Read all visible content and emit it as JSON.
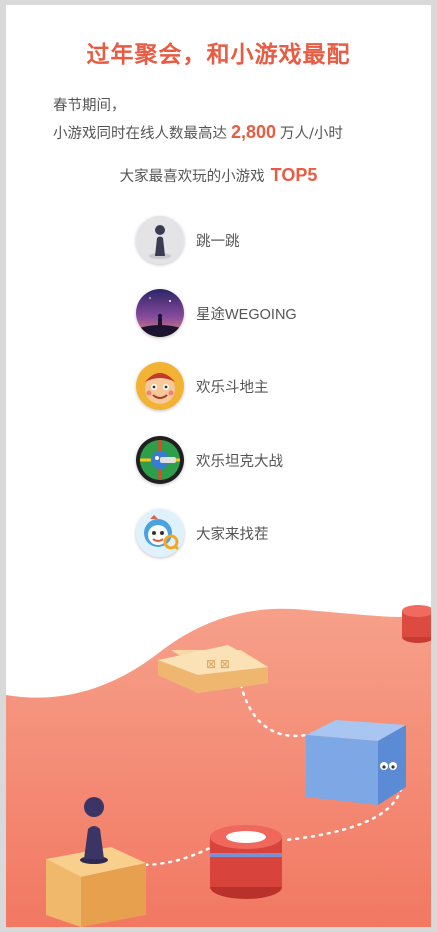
{
  "title": "过年聚会，和小游戏最配",
  "intro": {
    "line1": "春节期间，",
    "line2_prefix": "小游戏同时在线人数最高达",
    "peak_value": "2,800",
    "line2_suffix": "万人/小时"
  },
  "top_heading": {
    "text": "大家最喜欢玩的小游戏",
    "accent": "TOP5"
  },
  "games": [
    {
      "name": "跳一跳",
      "icon": "jump-jump-icon"
    },
    {
      "name": "星途WEGOING",
      "icon": "wegoing-icon"
    },
    {
      "name": "欢乐斗地主",
      "icon": "doudizhu-icon"
    },
    {
      "name": "欢乐坦克大战",
      "icon": "tank-battle-icon"
    },
    {
      "name": "大家来找茬",
      "icon": "find-difference-icon"
    }
  ],
  "colors": {
    "accent": "#e85c44",
    "text": "#555555",
    "wave": "#f47f6c"
  }
}
